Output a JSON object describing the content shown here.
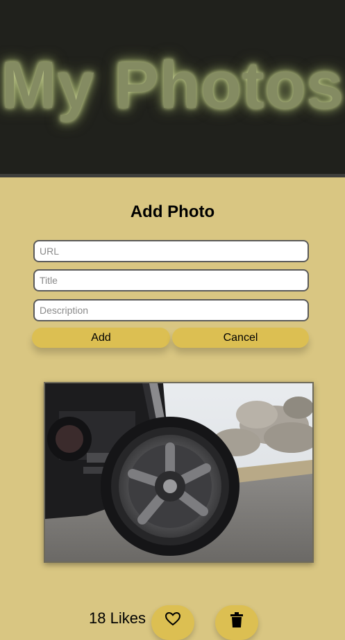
{
  "header": {
    "title": "My Photos"
  },
  "form": {
    "title": "Add Photo",
    "url_placeholder": "URL",
    "title_placeholder": "Title",
    "description_placeholder": "Description",
    "add_label": "Add",
    "cancel_label": "Cancel"
  },
  "photo": {
    "likes_text": "18 Likes",
    "like_icon": "heart-icon",
    "delete_icon": "trash-icon"
  },
  "colors": {
    "page_background": "#d9c682",
    "header_background": "#20211c",
    "button": "#dcbf52",
    "title_glow": "#848b62"
  }
}
